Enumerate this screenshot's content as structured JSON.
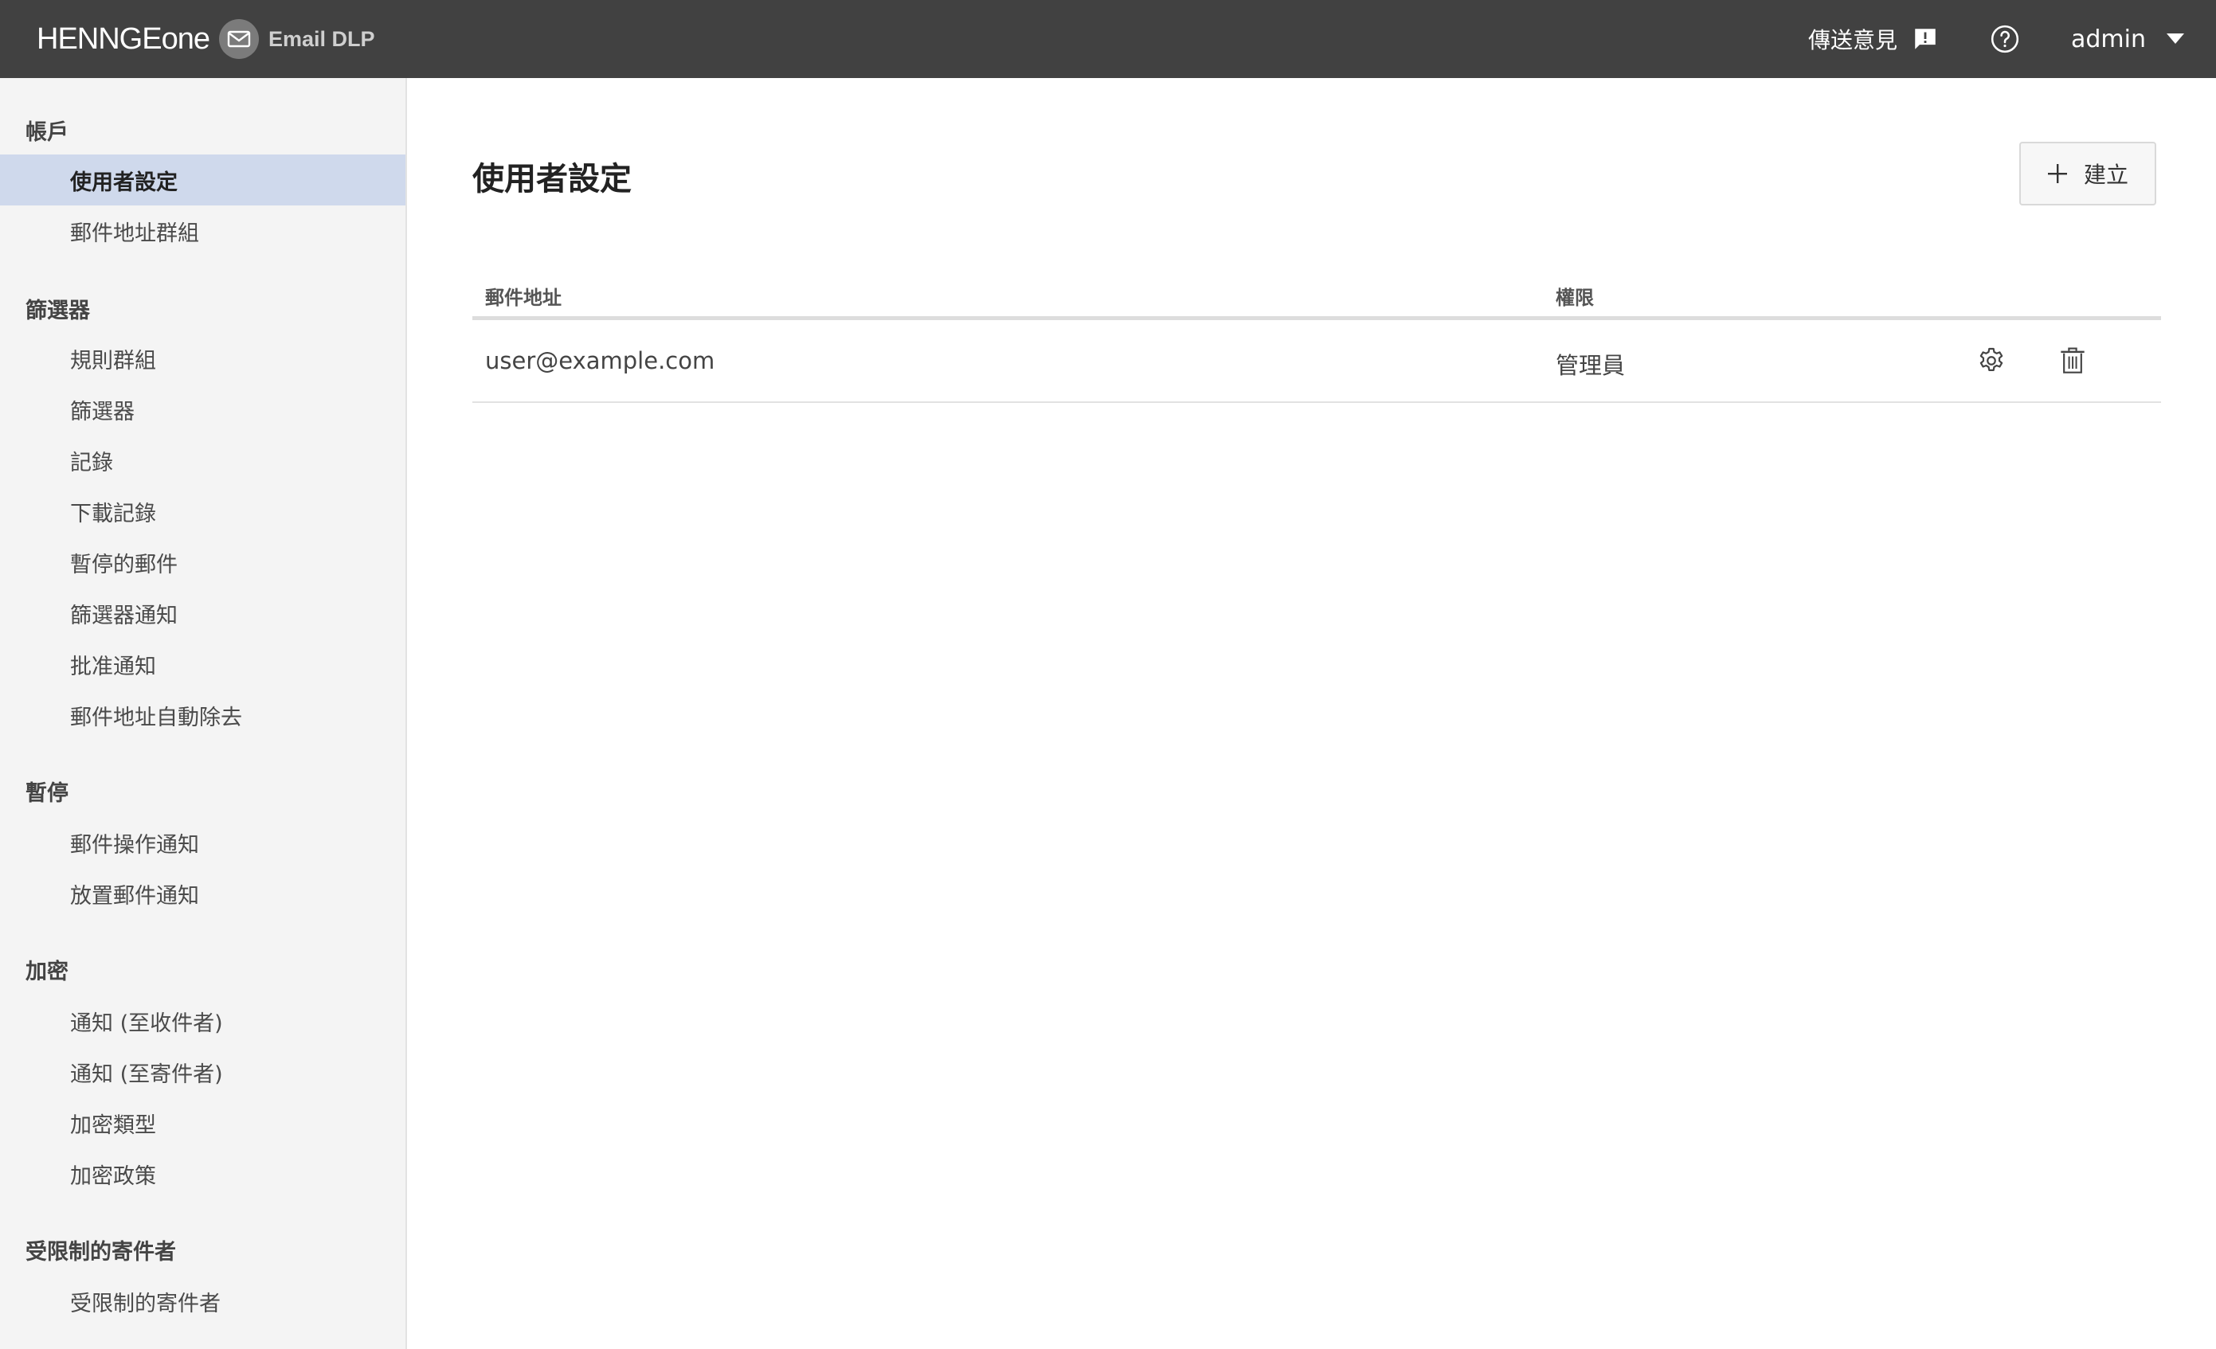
{
  "header": {
    "brand_name": "HENNGE",
    "brand_suffix": "one",
    "product": "Email DLP",
    "feedback_label": "傳送意見",
    "user_name": "admin"
  },
  "sidebar": {
    "sections": [
      {
        "title": "帳戶",
        "items": [
          "使用者設定",
          "郵件地址群組"
        ]
      },
      {
        "title": "篩選器",
        "items": [
          "規則群組",
          "篩選器",
          "記錄",
          "下載記錄",
          "暫停的郵件",
          "篩選器通知",
          "批准通知",
          "郵件地址自動除去"
        ]
      },
      {
        "title": "暫停",
        "items": [
          "郵件操作通知",
          "放置郵件通知"
        ]
      },
      {
        "title": "加密",
        "items": [
          "通知 (至收件者)",
          "通知 (至寄件者)",
          "加密類型",
          "加密政策"
        ]
      },
      {
        "title": "受限制的寄件者",
        "items": [
          "受限制的寄件者"
        ]
      }
    ],
    "active_item": "使用者設定"
  },
  "main": {
    "title": "使用者設定",
    "create_label": "建立",
    "table": {
      "columns": [
        "郵件地址",
        "權限"
      ],
      "rows": [
        {
          "email": "user@example.com",
          "permission": "管理員"
        }
      ]
    }
  },
  "colors": {
    "topbar": "#414141",
    "sidebar_bg": "#f4f4f4",
    "active_item_bg": "#cfd9ec"
  }
}
